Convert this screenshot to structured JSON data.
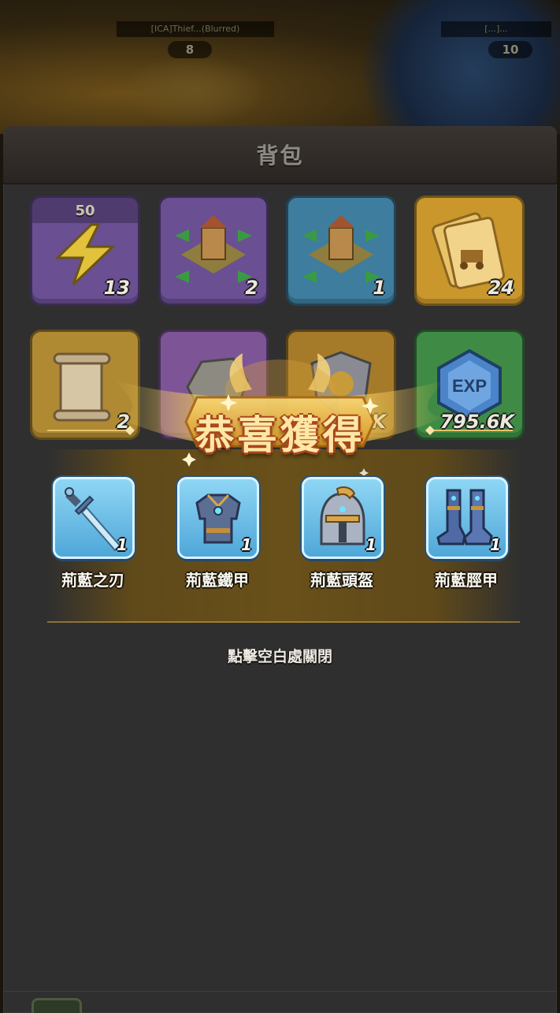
{
  "map": {
    "left_player_name": "[ICA]Thief...(Blurred)",
    "left_player_level": "8",
    "right_player_name": "[...]...",
    "right_player_level": "10"
  },
  "panel": {
    "title": "背包"
  },
  "grid": {
    "items": [
      {
        "name": "energy-bolt",
        "count": "13",
        "top_label": "50",
        "color": "#6a4f92"
      },
      {
        "name": "castle-relocate-purple",
        "count": "2",
        "color": "#6a4f92"
      },
      {
        "name": "castle-relocate-blue",
        "count": "1",
        "color": "#3e7d9d"
      },
      {
        "name": "wagon-ticket",
        "count": "24",
        "color": "#c9972c"
      },
      {
        "name": "scroll",
        "count": "2",
        "color": "#b08a33"
      },
      {
        "name": "stone",
        "count": "",
        "color": "#7d5596"
      },
      {
        "name": "shield-crest",
        "count": "K",
        "color": "#a57b2a"
      },
      {
        "name": "exp-gem",
        "count": "795.6K",
        "color": "#3f8b45"
      }
    ]
  },
  "reward_popup": {
    "title": "恭喜獲得",
    "items": [
      {
        "name": "荊藍之刃",
        "count": "1",
        "icon": "sword-icon"
      },
      {
        "name": "荊藍鐵甲",
        "count": "1",
        "icon": "chest-armor-icon"
      },
      {
        "name": "荊藍頭盔",
        "count": "1",
        "icon": "helmet-icon"
      },
      {
        "name": "荊藍脛甲",
        "count": "1",
        "icon": "boots-icon"
      }
    ],
    "close_hint": "點擊空白處關閉"
  }
}
